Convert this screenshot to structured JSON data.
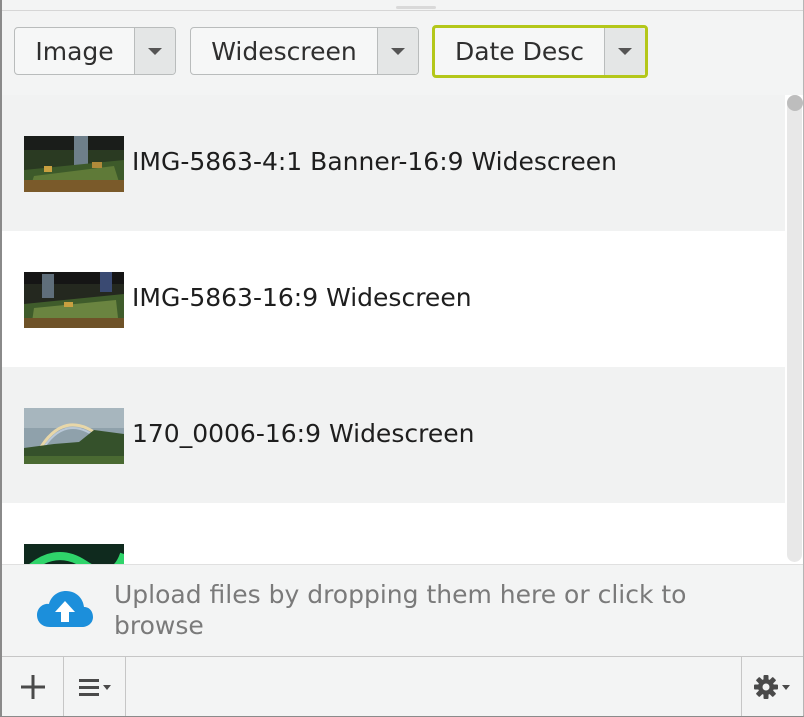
{
  "filters": {
    "type": {
      "label": "Image"
    },
    "crop": {
      "label": "Widescreen"
    },
    "sort": {
      "label": "Date Desc"
    }
  },
  "accent_color": "#b4c71a",
  "files": [
    {
      "name": "IMG-5863-4:1 Banner-16:9 Widescreen",
      "thumb": "hall-icon"
    },
    {
      "name": "IMG-5863-16:9 Widescreen",
      "thumb": "hall-icon"
    },
    {
      "name": "170_0006-16:9 Widescreen",
      "thumb": "rainbow-icon"
    },
    {
      "name": "...",
      "thumb": "aurora-icon"
    }
  ],
  "upload": {
    "text": "Upload files by dropping them here or click to browse",
    "icon": "cloud-upload-icon"
  },
  "footer": {
    "add_icon": "plus-icon",
    "menu_icon": "list-menu-icon",
    "settings_icon": "gear-icon"
  }
}
